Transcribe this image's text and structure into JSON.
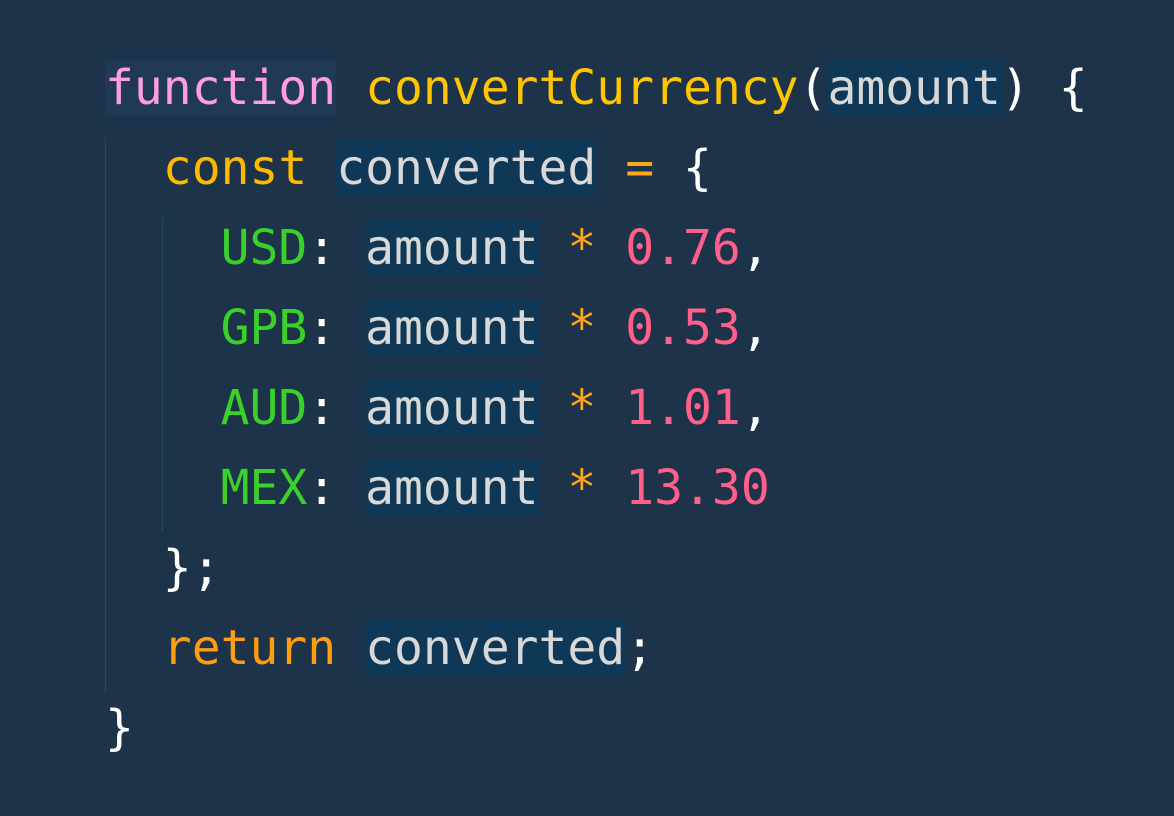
{
  "code": {
    "line1": {
      "keyword": "function",
      "space": " ",
      "name": "convertCurrency",
      "paren_open": "(",
      "param": "amount",
      "paren_close": ")",
      "space2": " ",
      "brace": "{"
    },
    "line2": {
      "indent": "  ",
      "keyword": "const",
      "space": " ",
      "var": "converted",
      "space2": " ",
      "op": "=",
      "space3": " ",
      "brace": "{"
    },
    "entries": [
      {
        "indent": "    ",
        "key": "USD",
        "colon": ":",
        "space": " ",
        "ident": "amount",
        "space2": " ",
        "op": "*",
        "space3": " ",
        "value": "0.76",
        "comma": ","
      },
      {
        "indent": "    ",
        "key": "GPB",
        "colon": ":",
        "space": " ",
        "ident": "amount",
        "space2": " ",
        "op": "*",
        "space3": " ",
        "value": "0.53",
        "comma": ","
      },
      {
        "indent": "    ",
        "key": "AUD",
        "colon": ":",
        "space": " ",
        "ident": "amount",
        "space2": " ",
        "op": "*",
        "space3": " ",
        "value": "1.01",
        "comma": ","
      },
      {
        "indent": "    ",
        "key": "MEX",
        "colon": ":",
        "space": " ",
        "ident": "amount",
        "space2": " ",
        "op": "*",
        "space3": " ",
        "value": "13.30",
        "comma": ""
      }
    ],
    "line7": {
      "indent": "  ",
      "brace": "}",
      "semi": ";"
    },
    "line8": {
      "indent": "  ",
      "keyword": "return",
      "space": " ",
      "var": "converted",
      "semi": ";"
    },
    "line9": {
      "brace": "}"
    }
  },
  "colors": {
    "background": "#1c3349",
    "function_keyword": "#ff9de0",
    "function_name": "#ffc500",
    "keyword": "#ffba00",
    "identifier": "#d8d8d8",
    "object_key": "#3bd12b",
    "number": "#ff5f8a",
    "operator": "#ffa71a",
    "highlight": "#0f3856"
  }
}
